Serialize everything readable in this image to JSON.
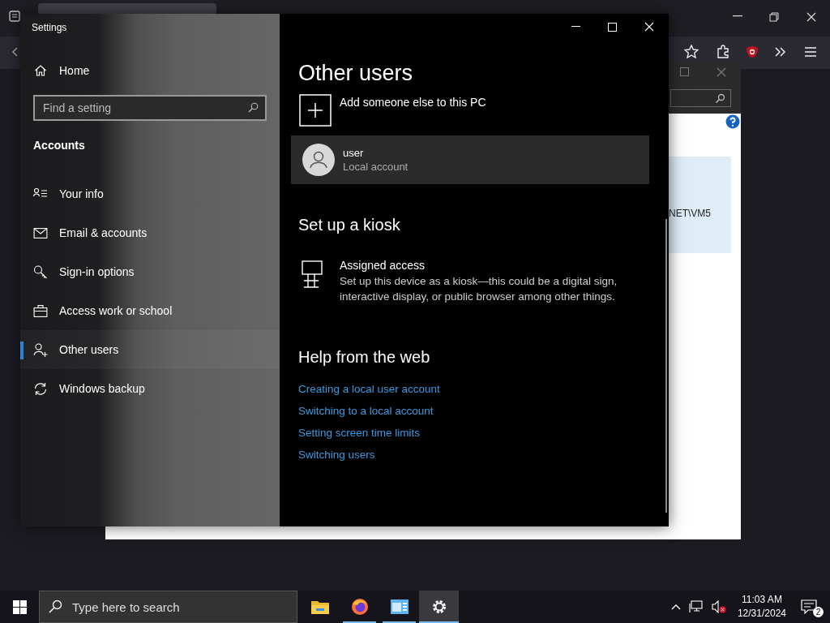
{
  "background_dialog": {
    "visible_text": "NET\\VM5"
  },
  "settings": {
    "title": "Settings",
    "home": "Home",
    "search": {
      "placeholder": "Find a setting"
    },
    "section": "Accounts",
    "nav": [
      {
        "label": "Your info",
        "selected": false
      },
      {
        "label": "Email & accounts",
        "selected": false
      },
      {
        "label": "Sign-in options",
        "selected": false
      },
      {
        "label": "Access work or school",
        "selected": false
      },
      {
        "label": "Other users",
        "selected": true
      },
      {
        "label": "Windows backup",
        "selected": false
      }
    ],
    "heading": "Other users",
    "add_user": "Add someone else to this PC",
    "user": {
      "name": "user",
      "account_type": "Local account"
    },
    "kiosk_heading": "Set up a kiosk",
    "kiosk": {
      "title": "Assigned access",
      "description": "Set up this device as a kiosk—this could be a digital sign, interactive display, or public browser among other things."
    },
    "help_heading": "Help from the web",
    "help_links": [
      "Creating a local user account",
      "Switching to a local account",
      "Setting screen time limits",
      "Switching users"
    ]
  },
  "taskbar": {
    "search": {
      "placeholder": "Type here to search"
    },
    "apps": [
      {
        "running": false,
        "selected": false
      },
      {
        "running": true,
        "selected": false
      },
      {
        "running": true,
        "selected": false
      },
      {
        "running": true,
        "selected": true
      }
    ],
    "time": "11:03 AM",
    "date": "12/31/2024",
    "notification_count": "2"
  }
}
